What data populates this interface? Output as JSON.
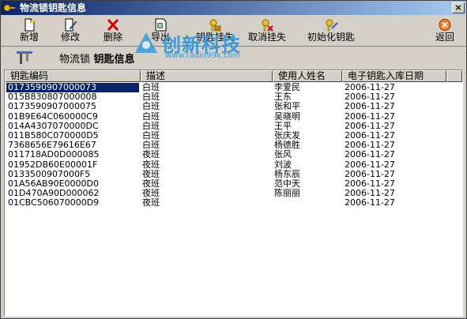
{
  "window": {
    "title": "物流锁钥匙信息",
    "close_glyph": "×"
  },
  "toolbar": [
    {
      "id": "new",
      "label": "新增",
      "icon": "new-document-icon"
    },
    {
      "id": "edit",
      "label": "修改",
      "icon": "edit-document-icon"
    },
    {
      "id": "delete",
      "label": "删除",
      "icon": "delete-x-icon"
    },
    {
      "id": "export",
      "label": "导出",
      "icon": "export-excel-icon"
    },
    {
      "id": "key-hang",
      "label": "钥匙挂失",
      "icon": "key-lock-icon"
    },
    {
      "id": "cancel-hang",
      "label": "取消挂失",
      "icon": "key-unlock-icon"
    },
    {
      "id": "init-key",
      "label": "初始化钥匙",
      "icon": "key-init-icon"
    },
    {
      "id": "back",
      "label": "返回",
      "icon": "back-icon"
    }
  ],
  "subheader": {
    "prefix": "物流锁",
    "title": "钥匙信息"
  },
  "watermark": {
    "title": "创新科技",
    "url": "www.radio99k.com"
  },
  "table": {
    "columns": [
      "钥匙编码",
      "描述",
      "使用人姓名",
      "电子钥匙入库日期"
    ],
    "rows": [
      [
        "0173590907000073",
        "白班",
        "李爱民",
        "2006-11-27"
      ],
      [
        "015B830807000008",
        "白班",
        "王东",
        "2006-11-27"
      ],
      [
        "0173590907000075",
        "白班",
        "张和平",
        "2006-11-27"
      ],
      [
        "01B9E64C060000C9",
        "白班",
        "吴晓明",
        "2006-11-27"
      ],
      [
        "014A4307070000DC",
        "白班",
        "王平",
        "2006-11-27"
      ],
      [
        "011B580C070000D5",
        "白班",
        "张庆发",
        "2006-11-27"
      ],
      [
        "7368656E79616E67",
        "白班",
        "杨德胜",
        "2006-11-27"
      ],
      [
        "011718AD0D000085",
        "夜班",
        "张风",
        "2006-11-27"
      ],
      [
        "01952DB60E00001F",
        "夜班",
        "刘波",
        "2006-11-27"
      ],
      [
        "0133500907000F5",
        "夜班",
        "杨东辰",
        "2006-11-27"
      ],
      [
        "01A56AB90E0000D0",
        "夜班",
        "范中天",
        "2006-11-27"
      ],
      [
        "01D470A90D000062",
        "夜班",
        "陈丽丽",
        "2006-11-27"
      ],
      [
        "01CBC506070000D9",
        "夜班",
        "",
        "2006-11-27"
      ]
    ],
    "selected_row": 0
  }
}
